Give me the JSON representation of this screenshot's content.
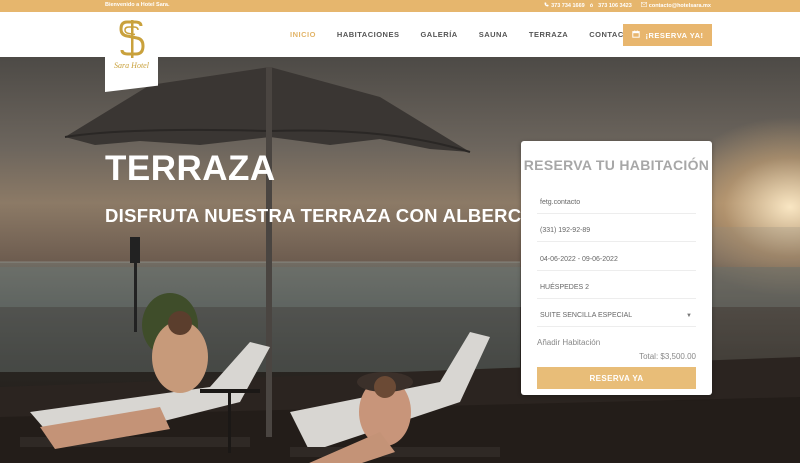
{
  "topbar": {
    "welcome": "Bienvenido a Hotel Sara.",
    "phone_1": "373 734 1669",
    "separator": "ó",
    "phone_2": "373 106 3423",
    "email": "contacto@hotelsara.mx"
  },
  "logo": {
    "text": "Sara Hotel"
  },
  "nav": {
    "items": [
      {
        "label": "INICIO",
        "active": true
      },
      {
        "label": "HABITACIONES",
        "active": false
      },
      {
        "label": "GALERÍA",
        "active": false
      },
      {
        "label": "SAUNA",
        "active": false
      },
      {
        "label": "TERRAZA",
        "active": false
      },
      {
        "label": "CONTACTO",
        "active": false
      }
    ],
    "reserve_button": "¡RESERVA YA!"
  },
  "hero": {
    "title": "TERRAZA",
    "subtitle": "DISFRUTA NUESTRA TERRAZA CON ALBERCA"
  },
  "booking": {
    "title": "RESERVA TU HABITACIÓN",
    "name_value": "fetg.contacto",
    "phone_value": "(331) 192-92-89",
    "dates_value": "04-06-2022 - 09-06-2022",
    "guests_value": "HUÉSPEDES 2",
    "room_select_value": "SUITE SENCILLA ESPECIAL",
    "add_room": "Añadir Habitación",
    "total": "Total: $3,500.00",
    "submit": "RESERVA YA"
  },
  "colors": {
    "accent": "#e8b66e",
    "nav_active": "#e2b468",
    "logo_gold": "#c9a13c"
  },
  "icons": [
    "phone-icon",
    "email-icon",
    "calendar-icon",
    "caret-down-icon"
  ]
}
